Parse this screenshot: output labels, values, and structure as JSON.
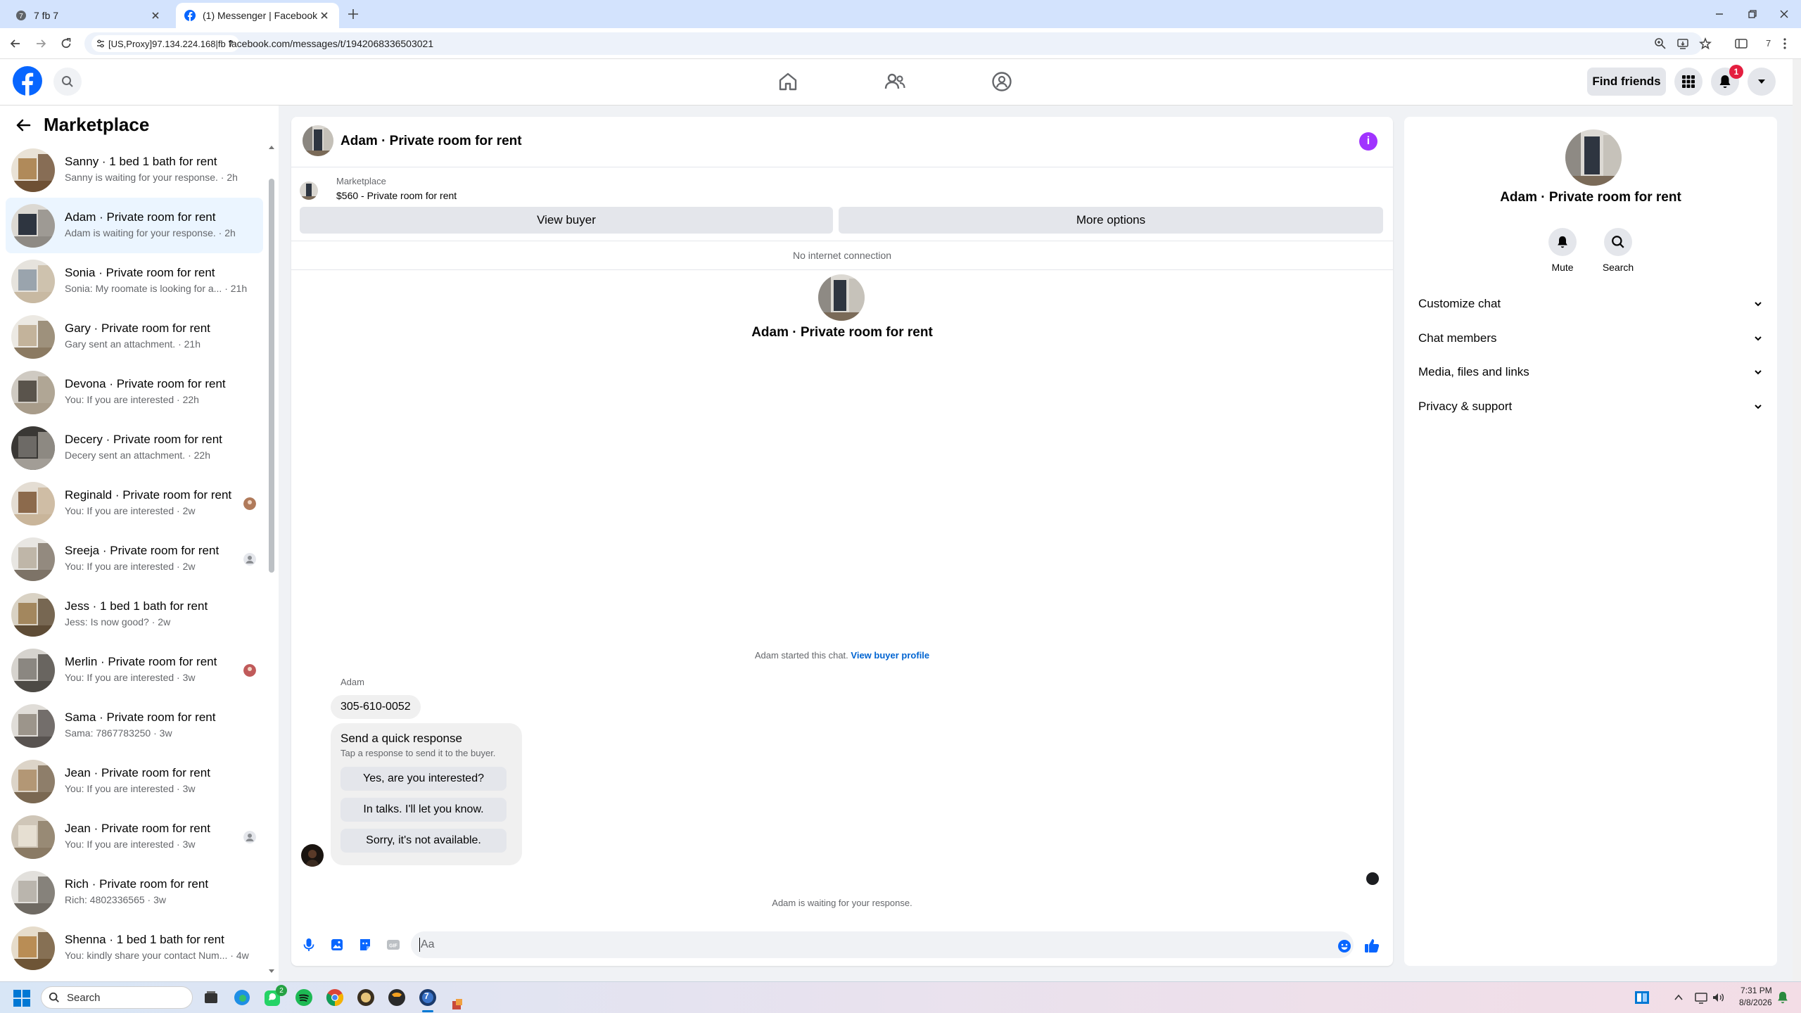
{
  "browser": {
    "tabs": [
      {
        "title": "7 fb 7",
        "active": false
      },
      {
        "title": "(1) Messenger | Facebook",
        "active": true
      }
    ],
    "proxy_label": "[US,Proxy]97.134.224.168|fb 7",
    "url": "facebook.com/messages/t/1942068336503021",
    "profile_count": "7"
  },
  "fb_header": {
    "find_friends": "Find friends",
    "notification_count": "1"
  },
  "sidebar": {
    "title": "Marketplace",
    "conversations": [
      {
        "name": "Sanny · 1 bed 1 bath for rent",
        "preview": "Sanny is waiting for your response. · 2h",
        "active": false
      },
      {
        "name": "Adam · Private room for rent",
        "preview": "Adam is waiting for your response. · 2h",
        "active": true
      },
      {
        "name": "Sonia · Private room for rent",
        "preview": "Sonia: My roomate is looking for a... · 21h",
        "active": false
      },
      {
        "name": "Gary · Private room for rent",
        "preview": "Gary sent an attachment. · 21h",
        "active": false
      },
      {
        "name": "Devona · Private room for rent",
        "preview": "You: If you are interested · 22h",
        "active": false
      },
      {
        "name": "Decery · Private room for rent",
        "preview": "Decery sent an attachment. · 22h",
        "active": false
      },
      {
        "name": "Reginald · Private room for rent",
        "preview": "You: If you are interested · 2w",
        "active": false
      },
      {
        "name": "Sreeja · Private room for rent",
        "preview": "You: If you are interested · 2w",
        "active": false
      },
      {
        "name": "Jess · 1 bed 1 bath for rent",
        "preview": "Jess: Is now good? · 2w",
        "active": false
      },
      {
        "name": "Merlin · Private room for rent",
        "preview": "You: If you are interested · 3w",
        "active": false
      },
      {
        "name": "Sama · Private room for rent",
        "preview": "Sama: 7867783250 · 3w",
        "active": false
      },
      {
        "name": "Jean · Private room for rent",
        "preview": "You: If you are interested · 3w",
        "active": false
      },
      {
        "name": "Jean · Private room for rent",
        "preview": "You: If you are interested · 3w",
        "active": false
      },
      {
        "name": "Rich · Private room for rent",
        "preview": "Rich: 4802336565 · 3w",
        "active": false
      },
      {
        "name": "Shenna · 1 bed 1 bath for rent",
        "preview": "You: kindly share your contact Num... · 4w",
        "active": false
      }
    ]
  },
  "chat": {
    "title": "Adam · Private room for rent",
    "marketplace_label": "Marketplace",
    "listing": "$560 - Private room for rent",
    "view_buyer": "View buyer",
    "more_options": "More options",
    "connection_status": "No internet connection",
    "center_name": "Adam · Private room for rent",
    "started_text": "Adam started this chat.",
    "view_buyer_profile": "View buyer profile",
    "sender_name": "Adam",
    "message": "305-610-0052",
    "quick_response": {
      "title": "Send a quick response",
      "subtitle": "Tap a response to send it to the buyer.",
      "options": [
        "Yes, are you interested?",
        "In talks. I'll let you know.",
        "Sorry, it's not available."
      ]
    },
    "waiting_text": "Adam is waiting for your response.",
    "composer_placeholder": "Aa"
  },
  "details": {
    "name": "Adam · Private room for rent",
    "actions": [
      "Mute",
      "Search"
    ],
    "sections": [
      "Customize chat",
      "Chat members",
      "Media, files and links",
      "Privacy & support"
    ]
  },
  "taskbar": {
    "search_placeholder": "Search",
    "time": "7:31 PM",
    "date": "8/8/2026",
    "whatsapp_badge": "2",
    "app7_badge": "7"
  },
  "colors": {
    "fb_blue": "#0866ff",
    "messenger_purple": "#a033ff",
    "link_blue": "#0064d1",
    "active_row": "#ebf5ff",
    "badge_red": "#e41e3f"
  }
}
